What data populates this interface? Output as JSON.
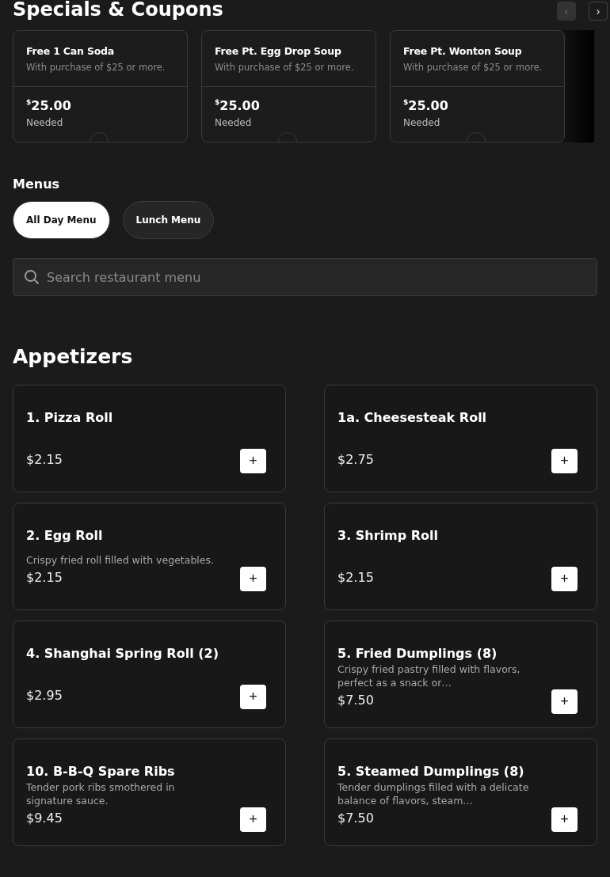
{
  "specials": {
    "title": "Specials & Coupons",
    "prev_button": {
      "label": "‹",
      "disabled": true
    },
    "next_button": {
      "label": "›",
      "disabled": false
    },
    "coupons": [
      {
        "title": "Free 1 Can Soda",
        "condition": "With purchase of $25 or more.",
        "currency": "$",
        "amount": "25.00",
        "note": "Needed"
      },
      {
        "title": "Free Pt. Egg Drop Soup",
        "condition": "With purchase of $25 or more.",
        "currency": "$",
        "amount": "25.00",
        "note": "Needed"
      },
      {
        "title": "Free Pt. Wonton Soup",
        "condition": "With purchase of $25 or more.",
        "currency": "$",
        "amount": "25.00",
        "note": "Needed"
      }
    ]
  },
  "menus": {
    "title": "Menus",
    "tabs": [
      {
        "label": "All Day Menu",
        "selected": true
      },
      {
        "label": "Lunch Menu",
        "selected": false
      }
    ]
  },
  "search": {
    "placeholder": "Search restaurant menu"
  },
  "section": {
    "title": "Appetizers",
    "add_label": "+",
    "items": [
      {
        "name": "1. Pizza Roll",
        "price": "$2.15"
      },
      {
        "name": "1a. Cheesesteak Roll",
        "price": "$2.75"
      },
      {
        "name": "2. Egg Roll",
        "description": "Crispy fried roll filled with vegetables.",
        "price": "$2.15"
      },
      {
        "name": "3. Shrimp Roll",
        "price": "$2.15"
      },
      {
        "name": "4. Shanghai Spring Roll (2)",
        "price": "$2.95"
      },
      {
        "name": "5. Fried Dumplings (8)",
        "description": "Crispy fried pastry filled with flavors, perfect as a snack or…",
        "price": "$7.50"
      },
      {
        "name": "10. B-B-Q Spare Ribs",
        "description": "Tender pork ribs smothered in signature sauce.",
        "price": "$9.45"
      },
      {
        "name": "5. Steamed Dumplings (8)",
        "description": "Tender dumplings filled with a delicate balance of flavors, steam…",
        "price": "$7.50"
      }
    ]
  }
}
